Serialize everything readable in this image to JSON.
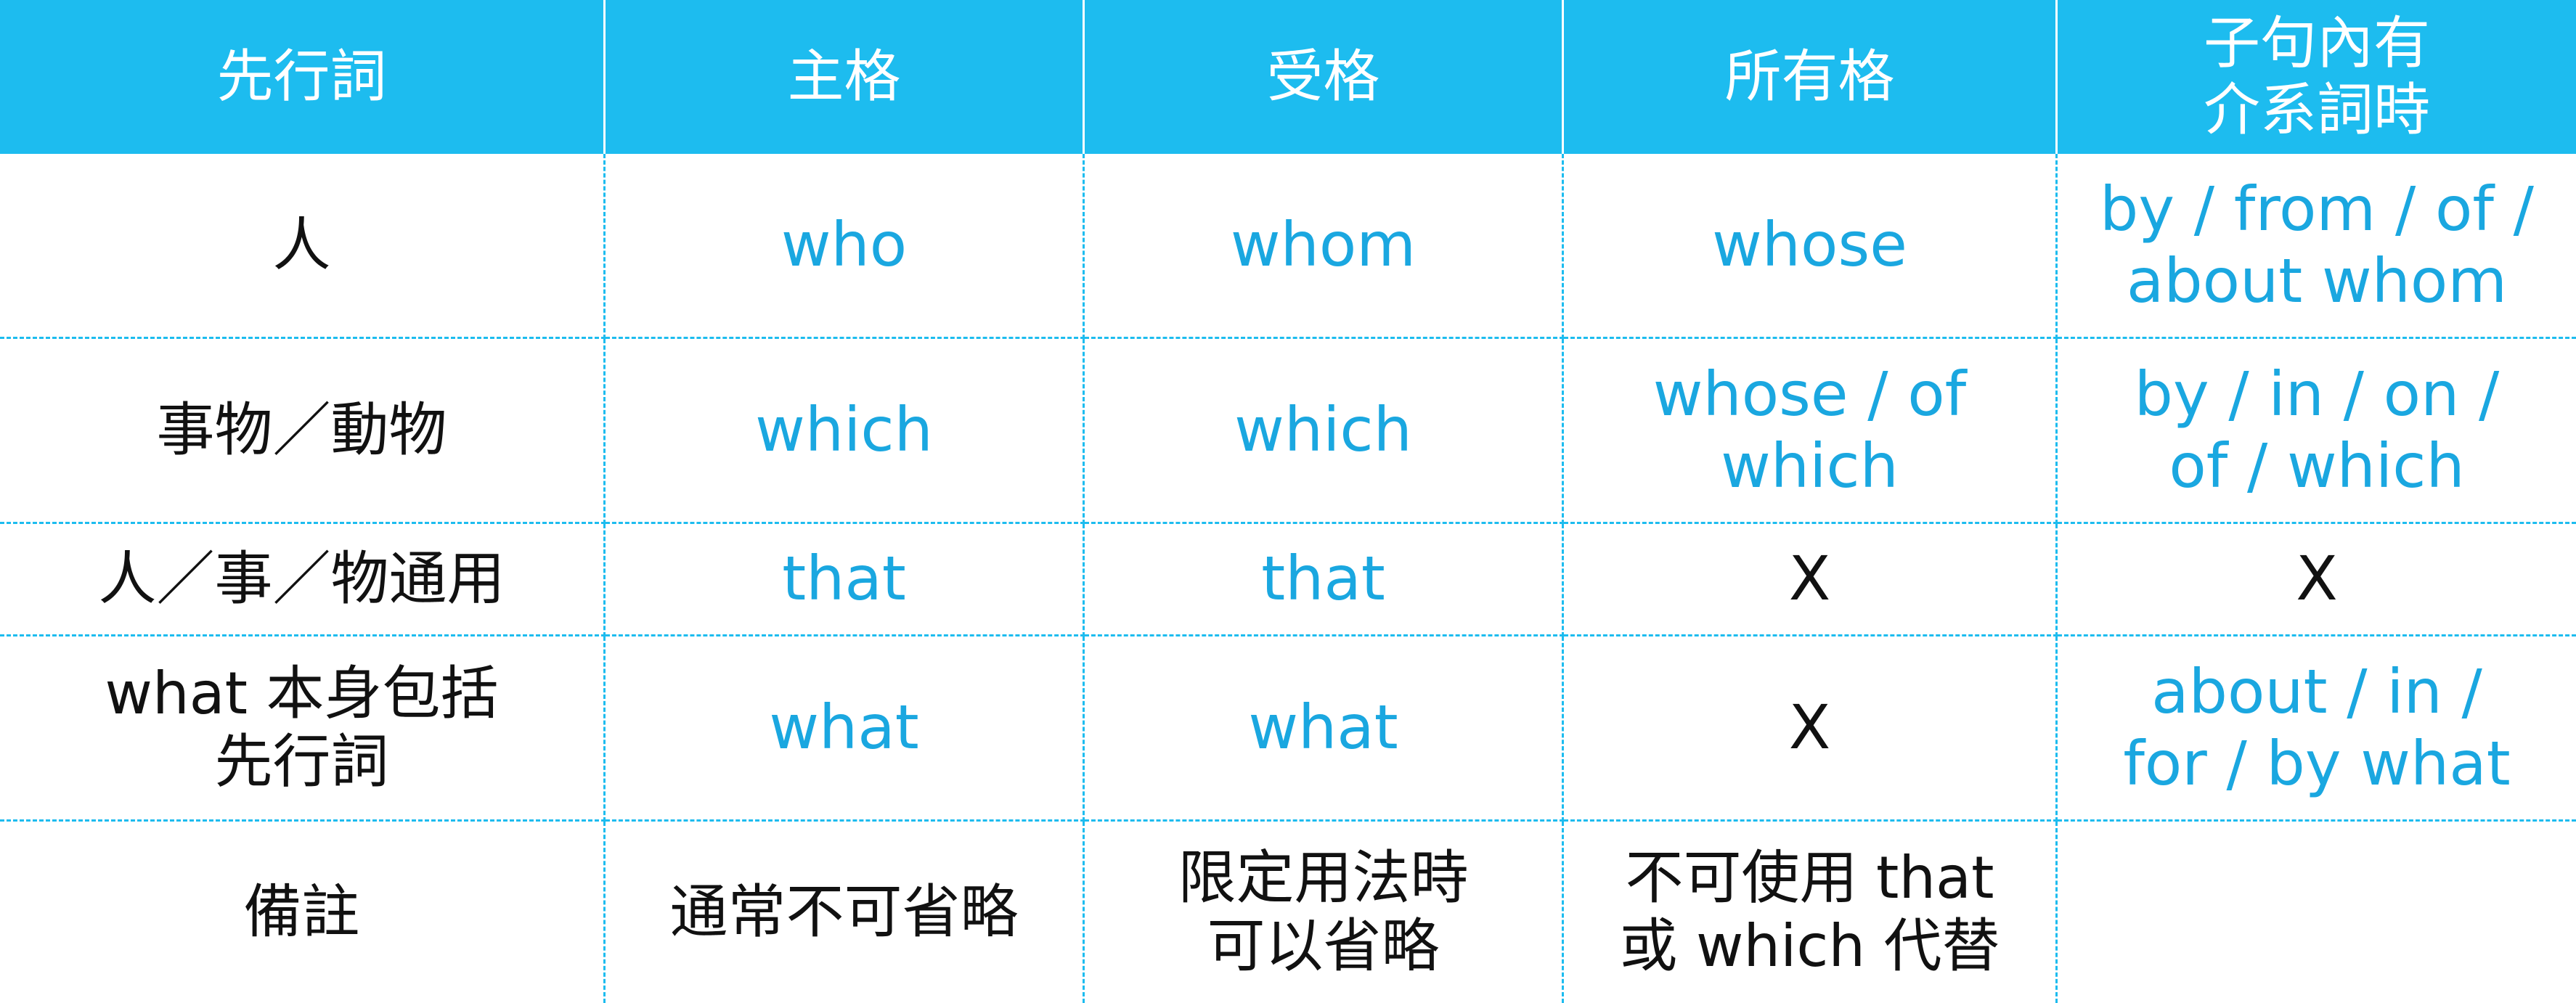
{
  "colors": {
    "header_bg": "#1dbcef",
    "header_text": "#ffffff",
    "english_text": "#1aa7e0",
    "chinese_text": "#111111",
    "divider": "#1dbcef"
  },
  "table": {
    "headers": [
      [
        "先行詞"
      ],
      [
        "主格"
      ],
      [
        "受格"
      ],
      [
        "所有格"
      ],
      [
        "子句內有",
        "介系詞時"
      ]
    ],
    "rows": [
      {
        "antecedent": [
          "人"
        ],
        "subjective": [
          "who"
        ],
        "objective": [
          "whom"
        ],
        "possessive": [
          "whose"
        ],
        "with_preposition": [
          "by / from / of /",
          "about whom"
        ]
      },
      {
        "antecedent": [
          "事物／動物"
        ],
        "subjective": [
          "which"
        ],
        "objective": [
          "which"
        ],
        "possessive": [
          "whose / of",
          "which"
        ],
        "with_preposition": [
          "by / in / on /",
          "of / which"
        ]
      },
      {
        "antecedent": [
          "人／事／物通用"
        ],
        "subjective": [
          "that"
        ],
        "objective": [
          "that"
        ],
        "possessive": [
          "X"
        ],
        "with_preposition": [
          "X"
        ]
      },
      {
        "antecedent": [
          "what 本身包括",
          "先行詞"
        ],
        "subjective": [
          "what"
        ],
        "objective": [
          "what"
        ],
        "possessive": [
          "X"
        ],
        "with_preposition": [
          "about / in /",
          "for / by what"
        ]
      },
      {
        "antecedent": [
          "備註"
        ],
        "subjective": [
          "通常不可省略"
        ],
        "objective": [
          "限定用法時",
          "可以省略"
        ],
        "possessive": [
          "不可使用 that",
          "或 which 代替"
        ],
        "with_preposition": []
      }
    ]
  }
}
